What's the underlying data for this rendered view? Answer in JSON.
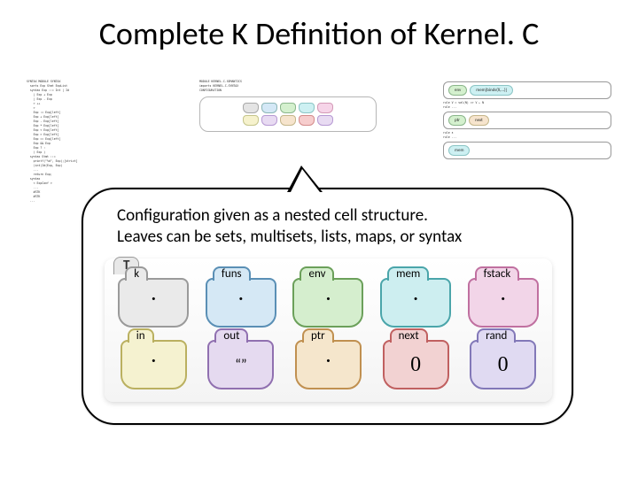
{
  "title": "Complete K Definition of Kernel. C",
  "callout": {
    "line1": "Configuration  given as a nested cell structure.",
    "line2": "Leaves can be sets, multisets, lists, maps, or syntax"
  },
  "diagram": {
    "outer_label": "T",
    "row1": [
      {
        "name": "k",
        "value": "·",
        "color": "grey"
      },
      {
        "name": "funs",
        "value": "·",
        "color": "blue"
      },
      {
        "name": "env",
        "value": "·",
        "color": "green"
      },
      {
        "name": "mem",
        "value": "·",
        "color": "cyan"
      },
      {
        "name": "fstack",
        "value": "·",
        "color": "pink"
      }
    ],
    "row2": [
      {
        "name": "in",
        "value": "·",
        "color": "yellow"
      },
      {
        "name": "out",
        "value": "“”",
        "color": "purple"
      },
      {
        "name": "ptr",
        "value": "·",
        "color": "orange"
      },
      {
        "name": "next",
        "value": "0",
        "color": "red"
      },
      {
        "name": "rand",
        "value": "0",
        "color": "lav"
      }
    ]
  }
}
